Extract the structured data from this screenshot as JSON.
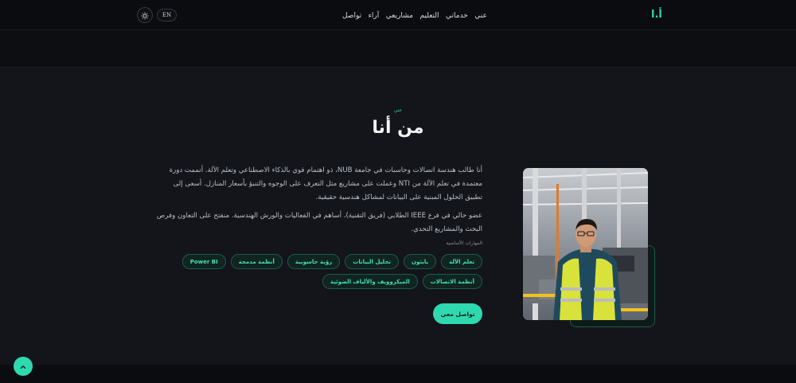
{
  "header": {
    "logo": "أ.ا",
    "nav": [
      "عني",
      "خدماتي",
      "التعليم",
      "مشاريعي",
      "آراء",
      "تواصل"
    ],
    "lang_label": "EN",
    "theme_icon": "sun-icon"
  },
  "about": {
    "eyebrow": "عني",
    "title": "من أنا",
    "bio_1": "أنا طالب هندسة اتصالات وحاسبات في جامعة NUB، ذو اهتمام قوي بالذكاء الاصطناعي وتعلم الآلة. أتممت دورة معتمدة في تعلم الآلة من NTI وعملت على مشاريع مثل التعرف على الوجوه والتنبؤ بأسعار المنازل. أسعى إلى تطبيق الحلول المبنية على البيانات لمشاكل هندسية حقيقية.",
    "bio_2": "عضو حالي في فرع IEEE الطلابي (فريق التقنية)، أساهم في الفعاليات والورش الهندسية. منفتح على التعاون وفرص البحث والمشاريع التحدي.",
    "skills_label": "المهارات الأساسية",
    "skills": [
      "تعلم الآلة",
      "بايثون",
      "تحليل البيانات",
      "رؤية حاسوبية",
      "أنظمة مدمجة",
      "Power BI",
      "أنظمة الاتصالات",
      "الميكروويف والألياف الضوئية"
    ],
    "cta_label": "تواصل معي"
  },
  "colors": {
    "accent": "#2fd9b0",
    "background": "#0c0d10",
    "section": "#13151b"
  },
  "icons": {
    "scroll_top": "chevron-up-icon"
  }
}
